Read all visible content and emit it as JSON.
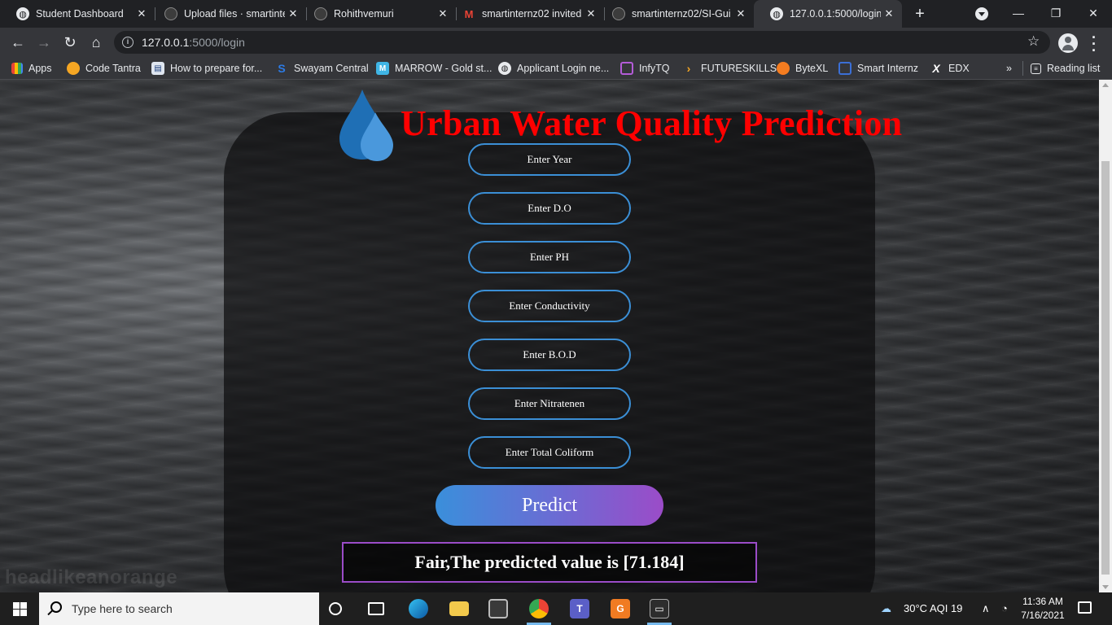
{
  "browser": {
    "tabs": [
      {
        "title": "Student Dashboard",
        "icon": "globe-icon"
      },
      {
        "title": "Upload files · smartinte",
        "icon": "github-icon"
      },
      {
        "title": "Rohithvemuri",
        "icon": "github-icon"
      },
      {
        "title": "smartinternz02 invited",
        "icon": "gmail-icon"
      },
      {
        "title": "smartinternz02/SI-Gui",
        "icon": "github-icon"
      },
      {
        "title": "127.0.0.1:5000/login",
        "icon": "globe-icon",
        "active": true
      }
    ],
    "close_glyph": "✕",
    "url_host": "127.0.0.1",
    "url_rest": ":5000/login",
    "bookmarks": [
      "Apps",
      "Code Tantra",
      "How to prepare for...",
      "Swayam Central",
      "MARROW - Gold st...",
      "Applicant Login ne...",
      "InfyTQ",
      "FUTURESKILLS",
      "ByteXL",
      "Smart Internz",
      "EDX"
    ],
    "bookmarks_overflow": "»",
    "reading_list": "Reading list"
  },
  "page": {
    "title": "Urban Water Quality Prediction",
    "fields": [
      {
        "placeholder": "Enter Year"
      },
      {
        "placeholder": "Enter D.O"
      },
      {
        "placeholder": "Enter PH"
      },
      {
        "placeholder": "Enter Conductivity"
      },
      {
        "placeholder": "Enter B.O.D"
      },
      {
        "placeholder": "Enter Nitratenen"
      },
      {
        "placeholder": "Enter Total Coliform"
      }
    ],
    "predict_label": "Predict",
    "result_text": "Fair,The predicted value is [71.184]",
    "watermark": "headlikeanorange",
    "colors": {
      "title": "#ff0000",
      "field_border": "#3b8fd6",
      "button_start": "#3a8fdb",
      "button_end": "#9b4cc8",
      "result_border": "#9b4cc8"
    }
  },
  "taskbar": {
    "search_placeholder": "Type here to search",
    "weather": "30°C  AQI 19",
    "time": "11:36 AM",
    "date": "7/16/2021"
  }
}
